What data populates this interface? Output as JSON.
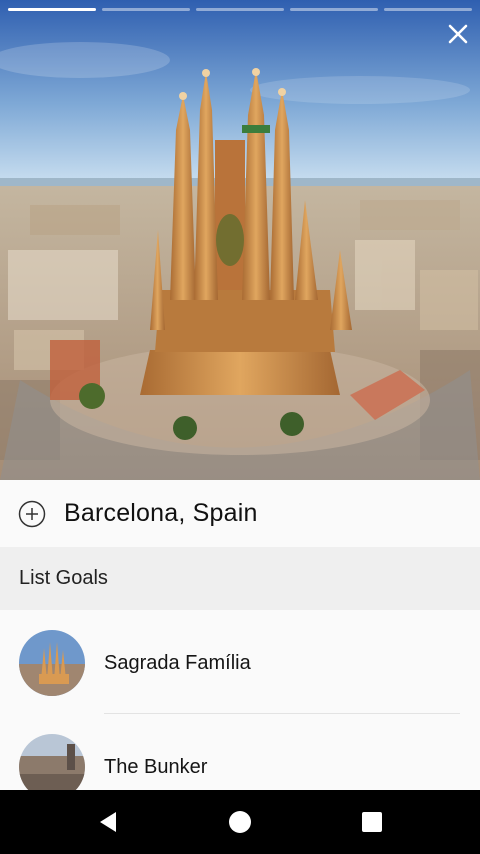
{
  "story": {
    "segments": [
      {
        "active": true
      },
      {
        "active": false
      },
      {
        "active": false
      },
      {
        "active": false
      },
      {
        "active": false
      }
    ]
  },
  "icons": {
    "close": "close-icon",
    "add": "add-circle-icon",
    "back": "back-icon",
    "home": "home-icon",
    "recents": "recents-icon"
  },
  "location": {
    "title": "Barcelona, Spain"
  },
  "list_section": {
    "header": "List Goals"
  },
  "goals": [
    {
      "name": "Sagrada Família"
    },
    {
      "name": "The Bunker"
    }
  ],
  "colors": {
    "sky_top": "#2f5fb0",
    "sky_bottom": "#cfe3f2",
    "stone": "#c98a44",
    "nav_background": "#000000"
  }
}
